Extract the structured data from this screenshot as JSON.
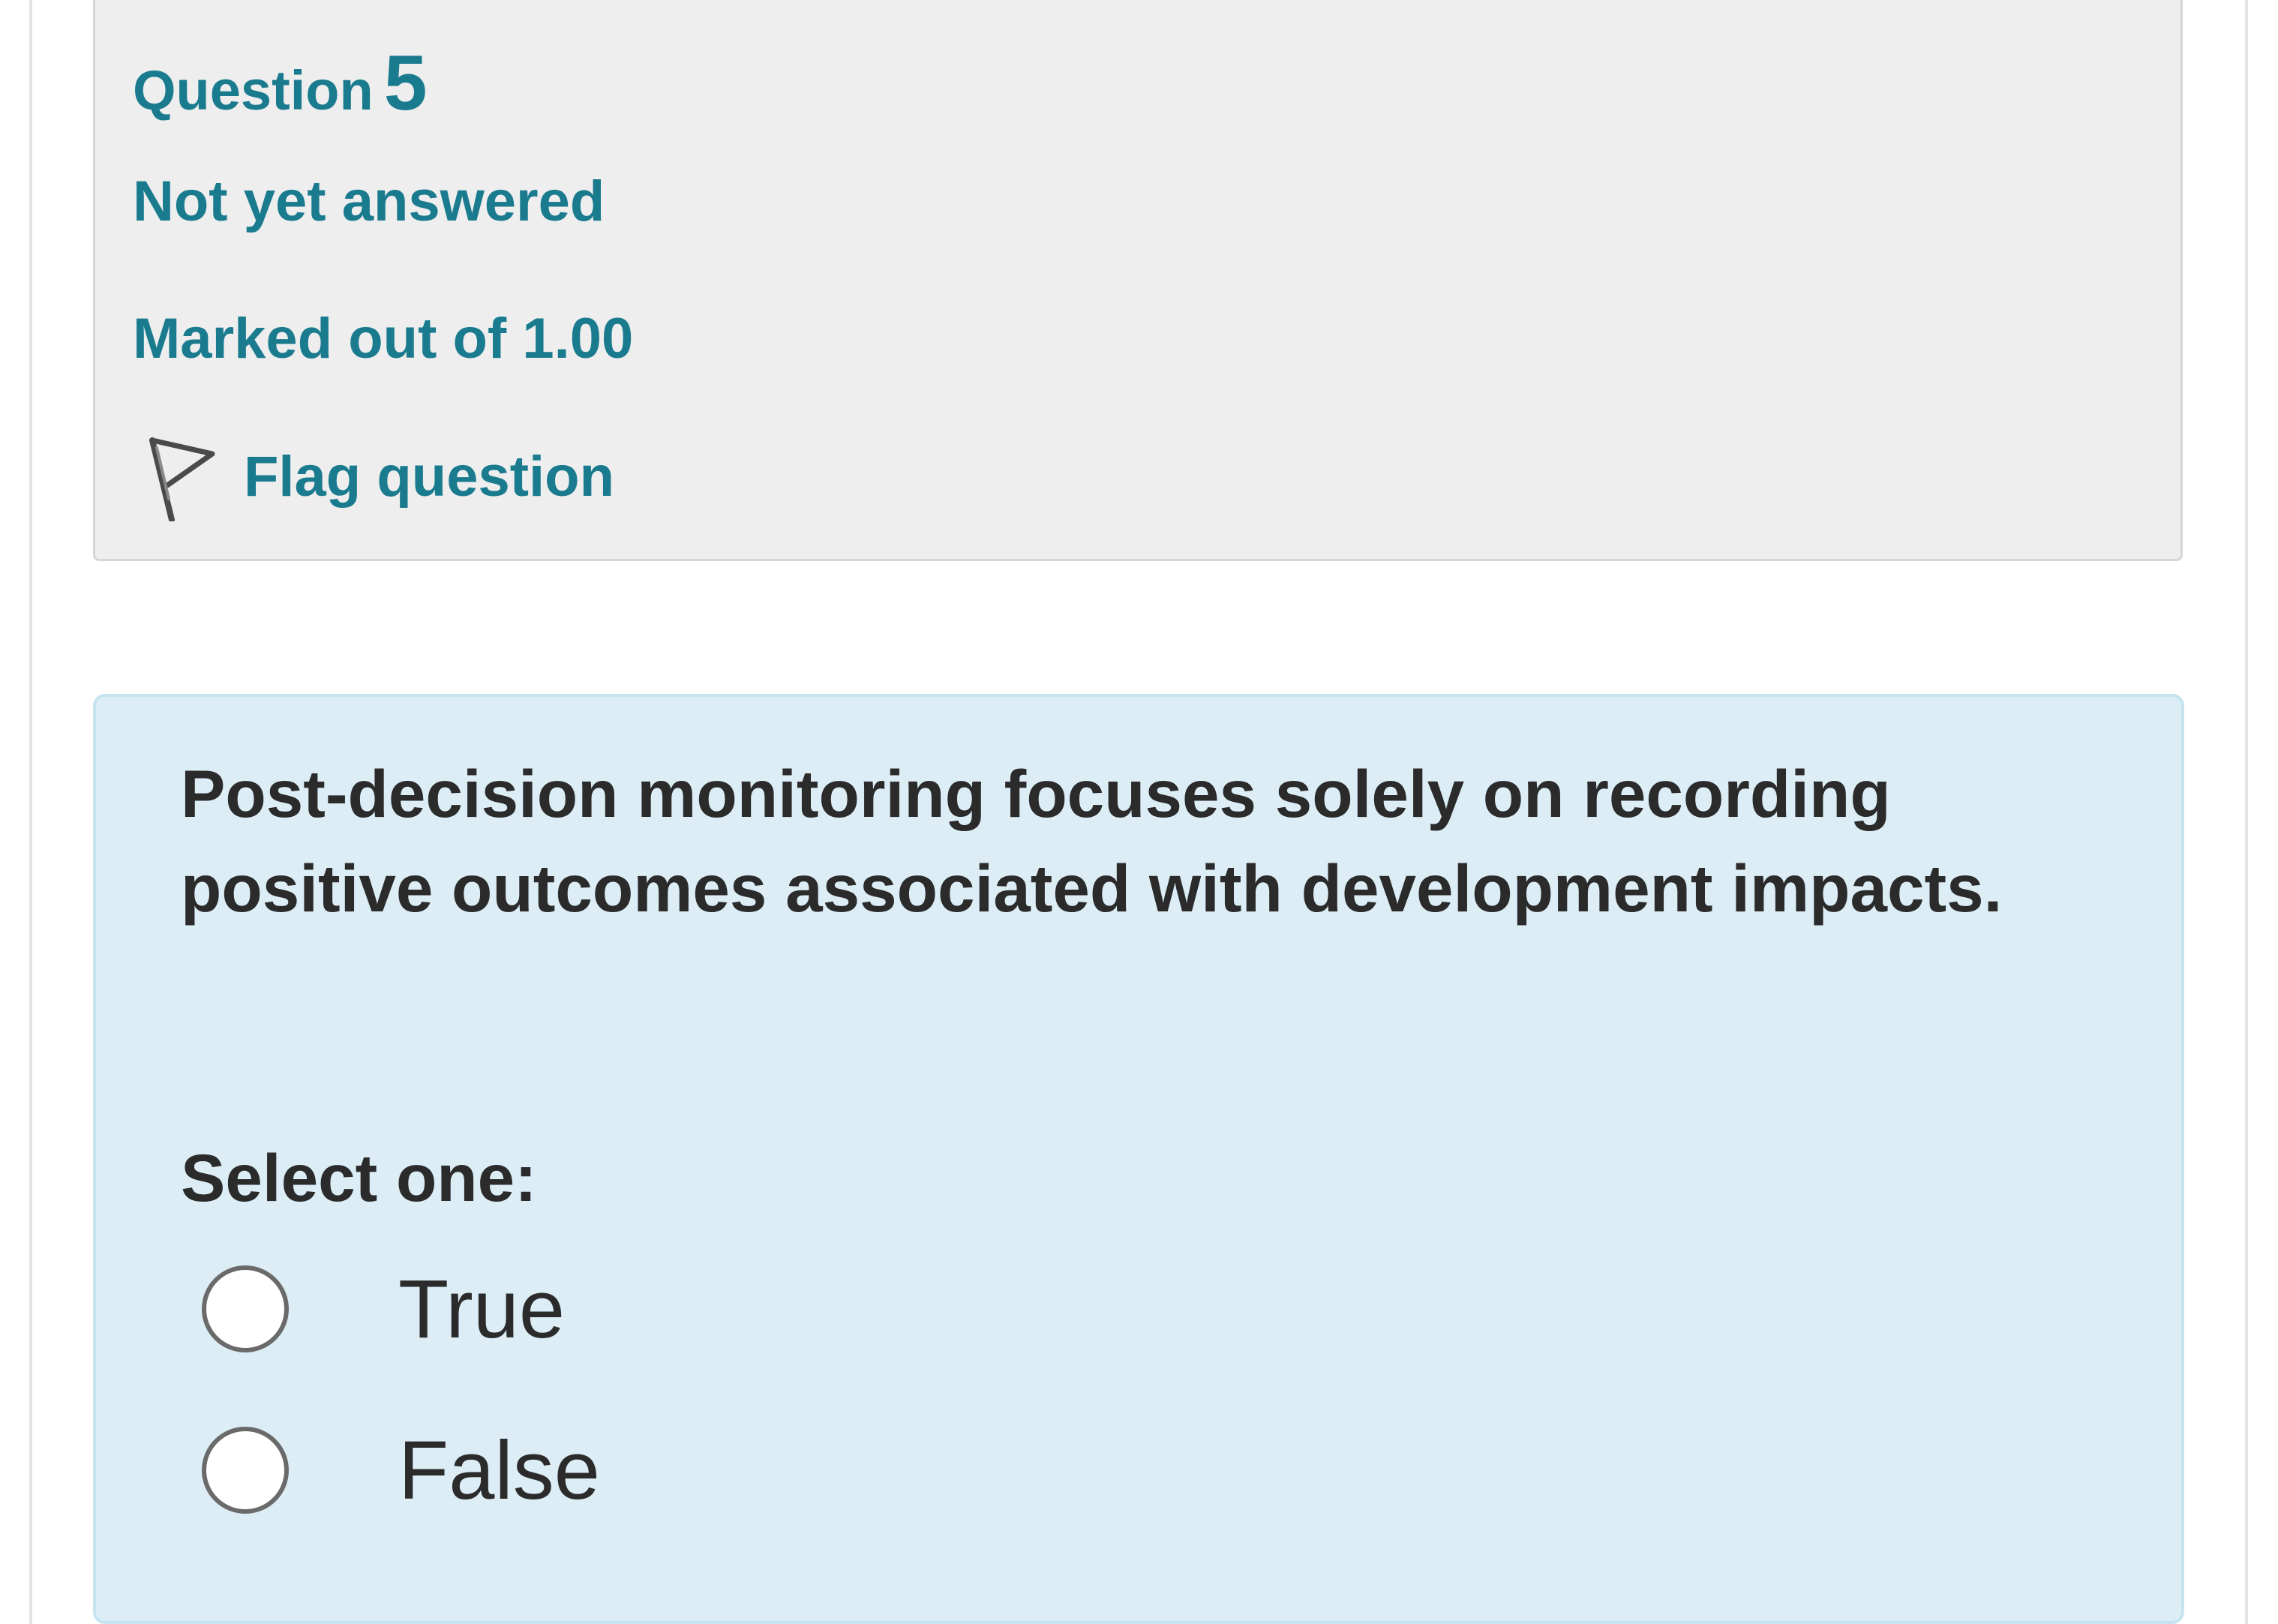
{
  "question_info": {
    "question_label": "Question",
    "question_number": "5",
    "state": "Not yet answered",
    "grade": "Marked out of 1.00",
    "flag_label": "Flag question",
    "flag_icon": "flag-outline-icon"
  },
  "question": {
    "text": "Post-decision monitoring focuses solely on recording positive outcomes associated with development impacts.",
    "prompt": "Select one:",
    "options": [
      {
        "label": "True",
        "selected": false
      },
      {
        "label": "False",
        "selected": false
      }
    ]
  },
  "colors": {
    "accent": "#1a7b8f",
    "info_background": "#eeeeee",
    "content_background": "#dcedf6",
    "text": "#2b2b2b"
  }
}
